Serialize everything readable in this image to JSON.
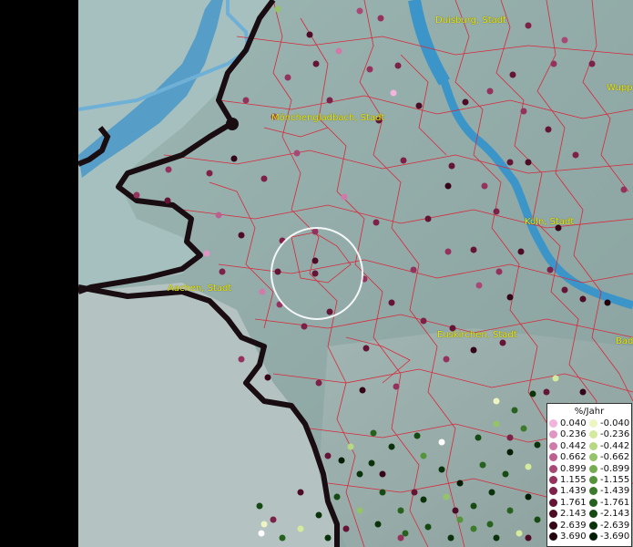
{
  "legend": {
    "title": "%/Jahr",
    "positive": [
      {
        "value": "0.040",
        "color": "#f2b3dc"
      },
      {
        "value": "0.236",
        "color": "#e095c3"
      },
      {
        "value": "0.442",
        "color": "#cf7aa9"
      },
      {
        "value": "0.662",
        "color": "#bd5f8f"
      },
      {
        "value": "0.899",
        "color": "#a94775"
      },
      {
        "value": "1.155",
        "color": "#94325d"
      },
      {
        "value": "1.439",
        "color": "#7d2148"
      },
      {
        "value": "1.761",
        "color": "#661436"
      },
      {
        "value": "2.143",
        "color": "#4e0b26"
      },
      {
        "value": "2.639",
        "color": "#370518"
      },
      {
        "value": "3.690",
        "color": "#22020c"
      }
    ],
    "negative": [
      {
        "value": "-0.040",
        "color": "#eef5c0"
      },
      {
        "value": "-0.236",
        "color": "#d4ea9c"
      },
      {
        "value": "-0.442",
        "color": "#b6d981"
      },
      {
        "value": "-0.662",
        "color": "#94c467"
      },
      {
        "value": "-0.899",
        "color": "#73ad4f"
      },
      {
        "value": "-1.155",
        "color": "#55943b"
      },
      {
        "value": "-1.439",
        "color": "#3c7b2b"
      },
      {
        "value": "-1.761",
        "color": "#26621e"
      },
      {
        "value": "-2.143",
        "color": "#164a13"
      },
      {
        "value": "-2.639",
        "color": "#0b330b"
      },
      {
        "value": "-3.690",
        "color": "#041d05"
      }
    ]
  },
  "cities": [
    {
      "id": "duisburg",
      "name": "Duisburg, Stadt"
    },
    {
      "id": "wuppertal",
      "name": "Wupp"
    },
    {
      "id": "moenchengladbach",
      "name": "Mönchengladbach, Stadt"
    },
    {
      "id": "koeln",
      "name": "Köln, Stadt"
    },
    {
      "id": "aachen",
      "name": "Aachen, Stadt"
    },
    {
      "id": "euskirchen",
      "name": "Euskirchen, Stadt"
    },
    {
      "id": "bad",
      "name": "Bad"
    }
  ],
  "colors": {
    "land": "#9bb3b0",
    "water": "#3b95c9",
    "border": "#1a0d12",
    "districts": "#d8283a",
    "city_text": "#e8e800",
    "marker_positive": "#7d2148",
    "marker_negative": "#0b330b"
  }
}
